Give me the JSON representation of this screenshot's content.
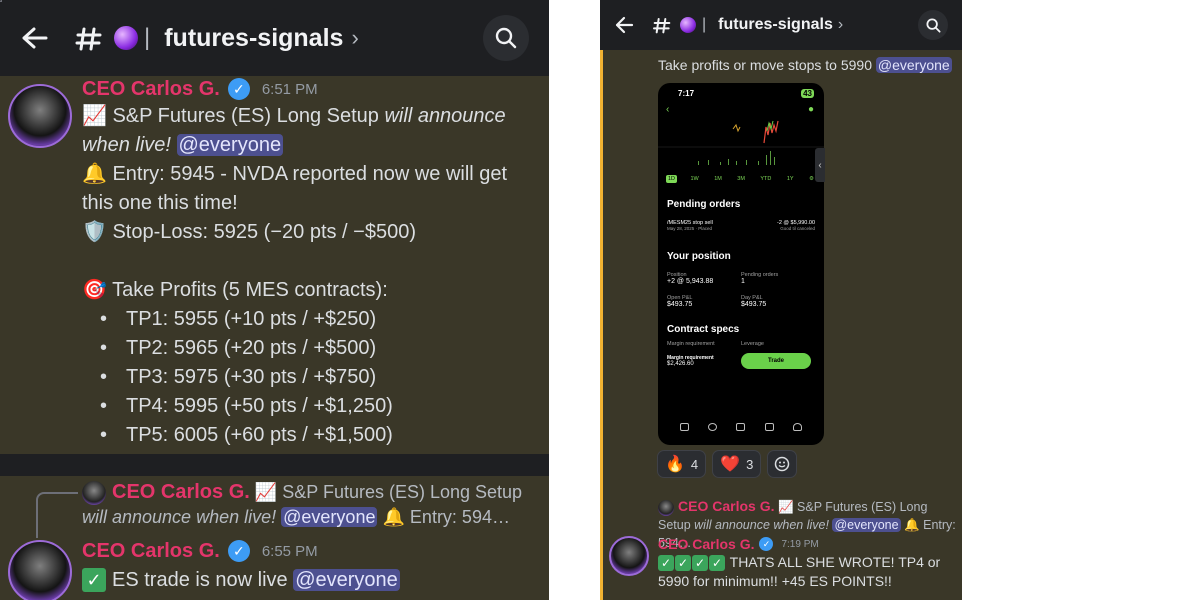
{
  "channel": {
    "name": "futures-signals"
  },
  "left": {
    "msg1": {
      "author": "CEO Carlos G.",
      "time": "6:51 PM",
      "title_plain": "S&P Futures (ES) Long Setup",
      "title_italic": "will announce when live!",
      "mention": "@everyone",
      "entry": "Entry: 5945 - NVDA reported now we will get this one this time!",
      "stoploss": "Stop-Loss: 5925 (−20 pts / −$500)",
      "take_profits": "Take Profits (5 MES contracts):",
      "targets": [
        "TP1: 5955 (+10 pts / +$250)",
        "TP2: 5965 (+20 pts / +$500)",
        "TP3: 5975 (+30 pts / +$750)",
        "TP4: 5995 (+50 pts / +$1,250)",
        "TP5: 6005 (+60 pts / +$1,500)"
      ]
    },
    "reply": {
      "author": "CEO Carlos G.",
      "text_plain": "S&P Futures (ES) Long Setup",
      "text_italic": "will announce when live!",
      "mention": "@everyone",
      "tail": "Entry: 594…"
    },
    "msg2": {
      "author": "CEO Carlos G.",
      "time": "6:55 PM",
      "text": "ES trade is now live",
      "mention": "@everyone"
    }
  },
  "right": {
    "top_text": "Take profits or move stops to 5990",
    "top_mention": "@everyone",
    "phone": {
      "clock": "7:17",
      "battery": "43",
      "ranges": [
        "1D",
        "1W",
        "1M",
        "3M",
        "YTD",
        "1Y"
      ],
      "pending_title": "Pending orders",
      "order_symbol": "/MESM25 stop sell",
      "order_date": "May 28, 2025 · Placed",
      "order_qty": "-2 @ $5,990.00",
      "order_tif": "Good til canceled",
      "position_title": "Your position",
      "position_label": "Position",
      "position_value": "+2 @ 5,943.88",
      "pending_label": "Pending orders",
      "pending_value": "1",
      "open_pl_label": "Open P&L",
      "open_pl_value": "$493.75",
      "day_pl_label": "Day P&L",
      "day_pl_value": "$493.75",
      "specs_title": "Contract specs",
      "margin_req_label": "Margin requirement",
      "leverage_label": "Leverage",
      "margin_req2_label": "Margin requirement",
      "margin_req2_value": "$2,426.60",
      "trade_label": "Trade"
    },
    "reactions": [
      {
        "emoji": "🔥",
        "count": "4"
      },
      {
        "emoji": "❤️",
        "count": "3"
      }
    ],
    "reply": {
      "author": "CEO Carlos G.",
      "text_plain": "S&P Futures (ES) Long Setup",
      "text_italic": "will announce when live!",
      "mention": "@everyone",
      "tail": "Entry: 594…"
    },
    "msg": {
      "author": "CEO Carlos G.",
      "time": "7:19 PM",
      "text": "THATS ALL SHE WROTE! TP4 or 5990 for minimum!! +45 ES POINTS!!"
    }
  },
  "colors": {
    "author": "#e4356b",
    "mention_bg": "#4d5090",
    "highlight_bg": "#3a3728",
    "verified": "#3d9cf5"
  }
}
